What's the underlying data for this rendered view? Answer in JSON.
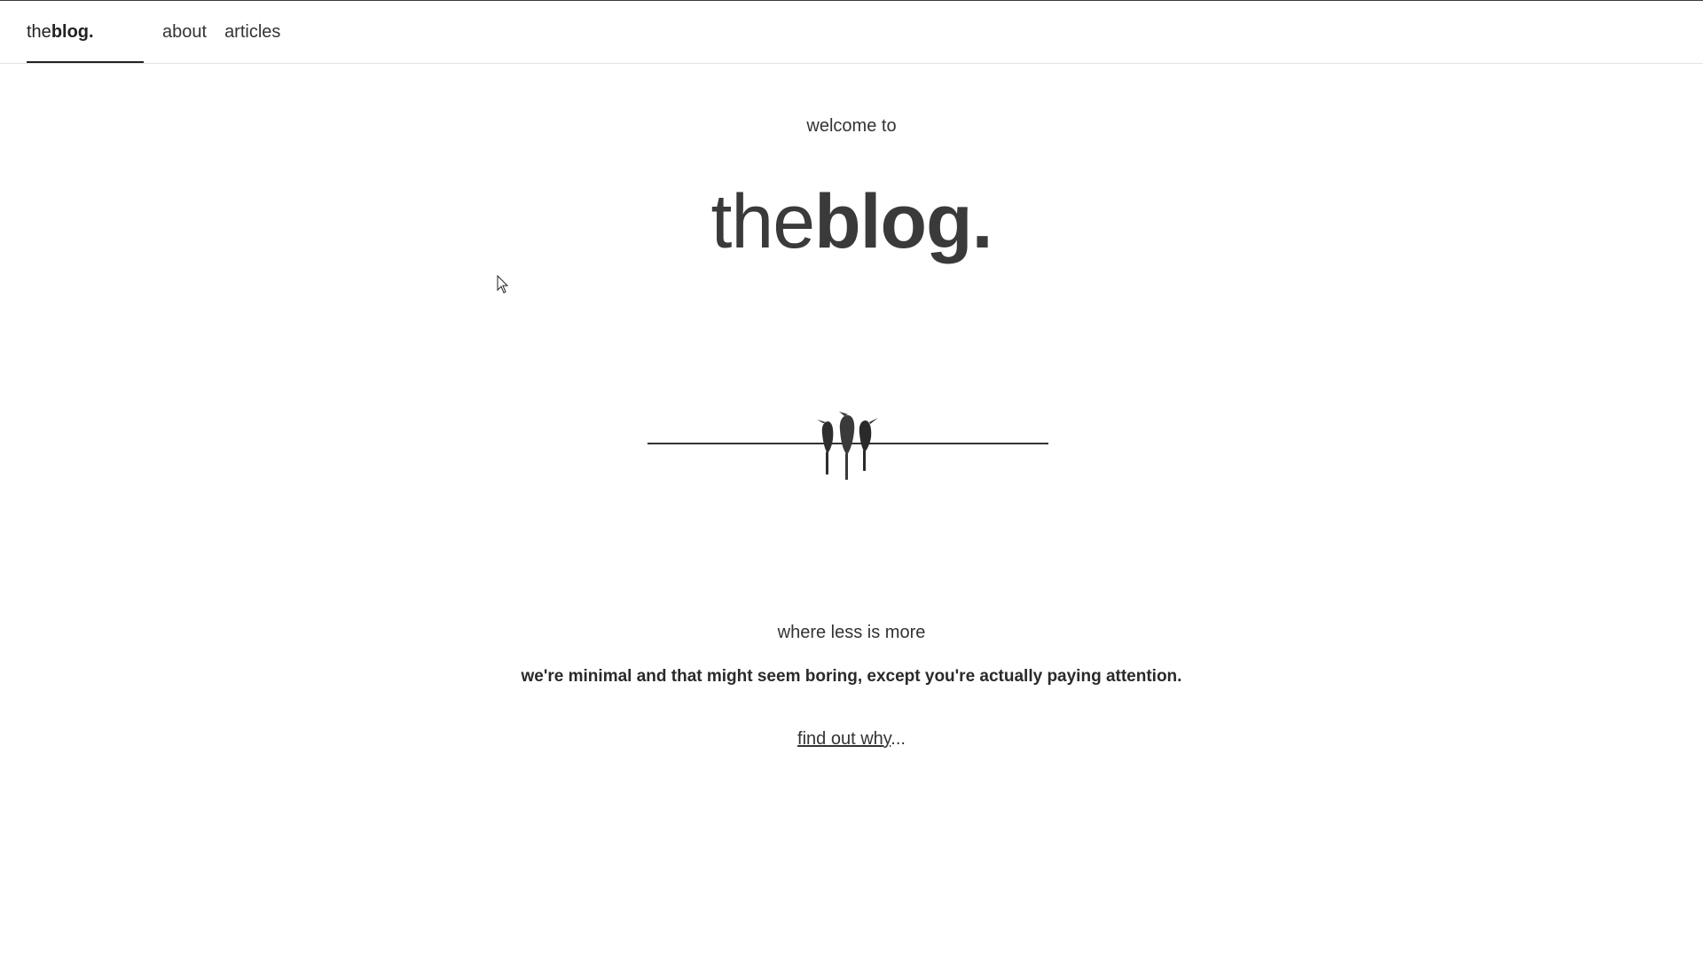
{
  "nav": {
    "brand_light": "the",
    "brand_bold": "blog.",
    "links": [
      {
        "label": "about"
      },
      {
        "label": "articles"
      }
    ]
  },
  "hero": {
    "welcome": "welcome to",
    "title_light": "the",
    "title_bold": "blog.",
    "illustration_icon": "birds-on-wire-icon"
  },
  "content": {
    "tagline": "where less is more",
    "statement": "we're minimal and that might seem boring, except you're actually paying attention.",
    "cta_link": "find out why",
    "cta_suffix": "..."
  },
  "colors": {
    "text": "#333333",
    "accent_underline": "#222222",
    "border": "#e4e4e4"
  }
}
